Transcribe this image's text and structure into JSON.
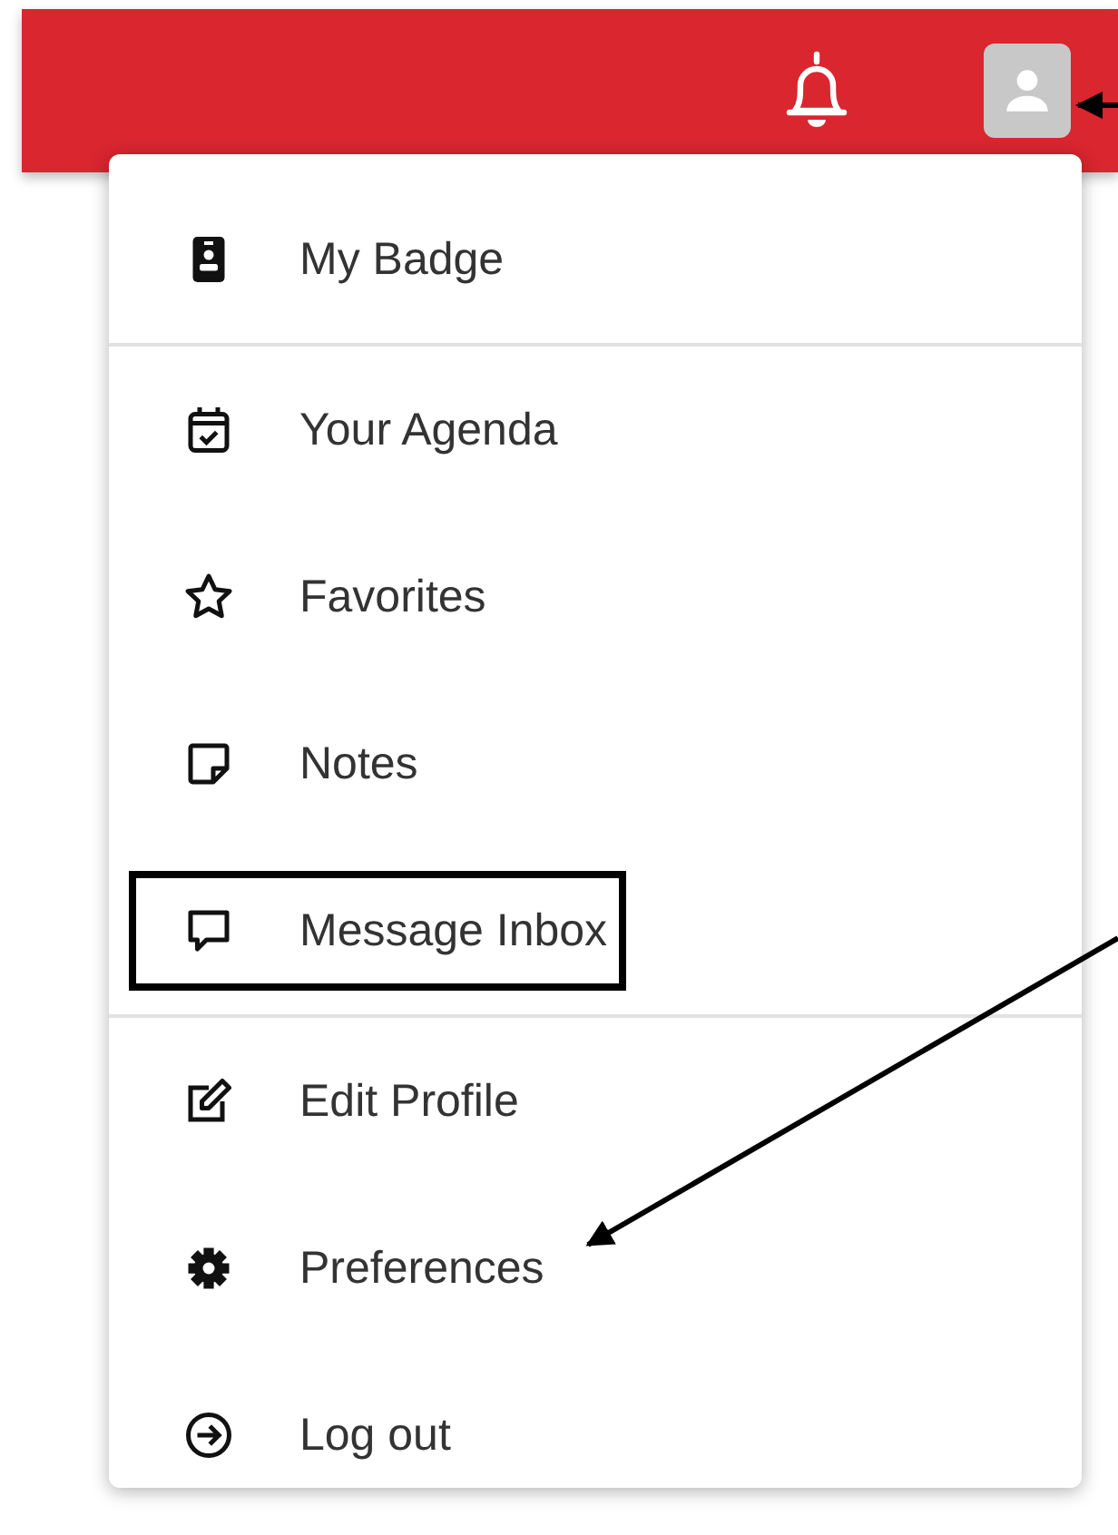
{
  "menu": {
    "sections": [
      {
        "items": [
          {
            "label": "My Badge",
            "outlined": false
          }
        ]
      },
      {
        "items": [
          {
            "label": "Your Agenda",
            "outlined": false
          },
          {
            "label": "Favorites",
            "outlined": false
          },
          {
            "label": "Notes",
            "outlined": false
          },
          {
            "label": "Message Inbox",
            "outlined": true
          }
        ]
      },
      {
        "items": [
          {
            "label": "Edit Profile",
            "outlined": false
          },
          {
            "label": "Preferences",
            "outlined": false
          },
          {
            "label": "Log out",
            "outlined": false
          }
        ]
      }
    ]
  }
}
